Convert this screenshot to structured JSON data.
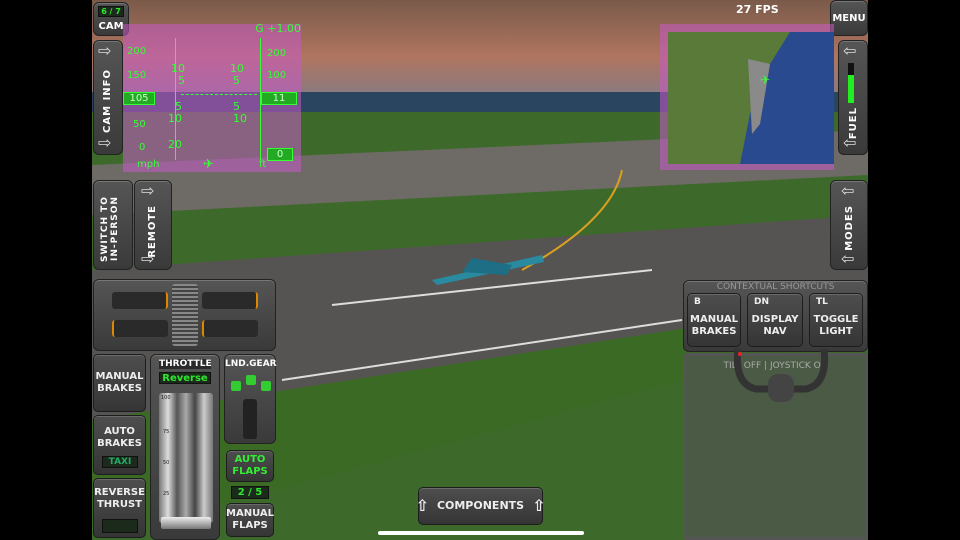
{
  "top": {
    "cam_counter": "6 / 7",
    "cam_label": "CAM",
    "fps": "27 FPS",
    "menu_label": "MENU"
  },
  "left": {
    "cam_info": "CAM INFO",
    "switch_view": "SWITCH TO IN-PERSON",
    "remote": "REMOTE"
  },
  "hud": {
    "g_force": "G +1.00",
    "speed": "105",
    "speed_unit": "mph",
    "altitude": "11",
    "alt_unit": "ft",
    "vspeed": "0",
    "speed_ticks": [
      "200",
      "150",
      "100",
      "50",
      "0"
    ],
    "alt_ticks": [
      "200",
      "100"
    ],
    "pitch_marks": [
      "10",
      "5",
      "5",
      "10",
      "20"
    ]
  },
  "right": {
    "fuel": "FUEL",
    "modes": "MODES",
    "fuel_level": 0.7
  },
  "shortcuts": {
    "title": "CONTEXTUAL SHORTCUTS",
    "items": [
      {
        "key": "B",
        "label": "MANUAL BRAKES"
      },
      {
        "key": "DN",
        "label": "DISPLAY NAV"
      },
      {
        "key": "TL",
        "label": "TOGGLE LIGHT"
      }
    ],
    "joystick_status": "TILT OFF | JOYSTICK ON"
  },
  "controls": {
    "manual_brakes": "MANUAL BRAKES",
    "auto_brakes": "AUTO BRAKES",
    "auto_brakes_mode": "TAXI",
    "reverse_thrust": "REVERSE THRUST",
    "throttle": "THROTTLE",
    "throttle_mode": "Reverse",
    "throttle_ticks": [
      "100",
      "75",
      "50",
      "25"
    ],
    "landing_gear": "LND.GEAR",
    "auto_flaps": "AUTO FLAPS",
    "flaps_setting": "2 / 5",
    "manual_flaps": "MANUAL FLAPS"
  },
  "components": "COMPONENTS",
  "colors": {
    "hud": "#33ff33",
    "hud_bg": "#c060c0",
    "panel": "#444444"
  }
}
